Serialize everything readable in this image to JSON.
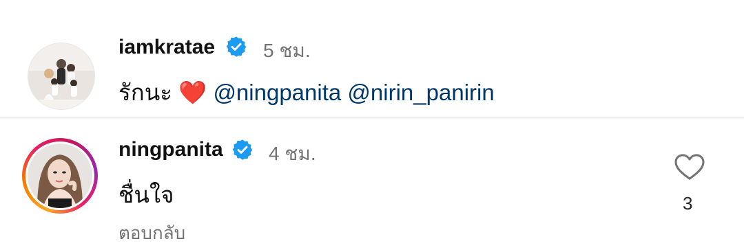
{
  "comments": [
    {
      "username": "iamkratae",
      "time": "5 ชม.",
      "text": "รักนะ",
      "emoji": "❤️",
      "mentions": [
        "@ningpanita",
        "@nirin_panirin"
      ],
      "avatar_icon": "family-photo-avatar",
      "verified": true
    },
    {
      "username": "ningpanita",
      "time": "4 ชม.",
      "text": "ชื่นใจ",
      "reply_label": "ตอบกลับ",
      "like_count": "3",
      "avatar_icon": "portrait-avatar-with-story-ring",
      "verified": true
    }
  ],
  "colors": {
    "verified_badge": "#1d9bf0",
    "mention": "#00376b",
    "meta_text": "#737373",
    "story_ring": [
      "#f9a825",
      "#e91e63",
      "#9c27b0"
    ]
  }
}
